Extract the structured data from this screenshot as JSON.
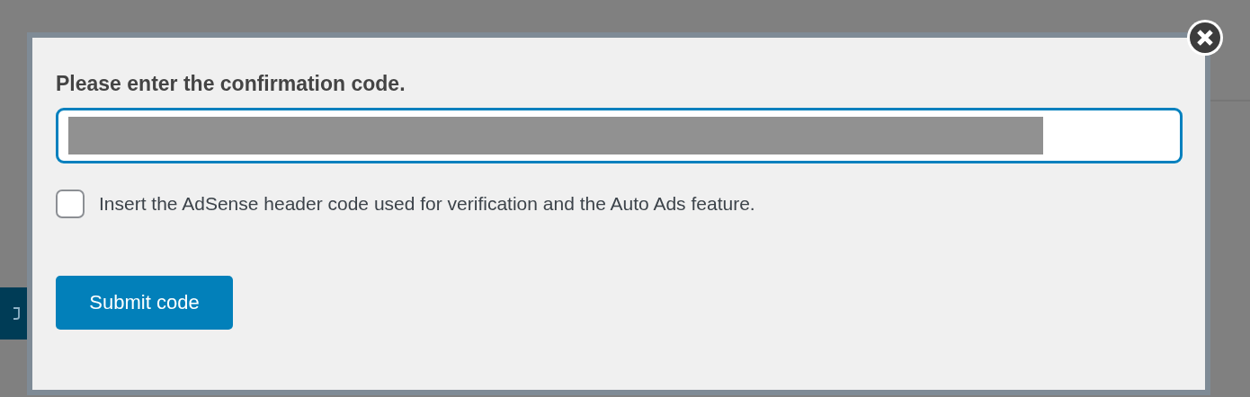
{
  "dialog": {
    "heading": "Please enter the confirmation code.",
    "code_field": {
      "redacted": true
    },
    "checkbox": {
      "label": "Insert the AdSense header code used for verification and the Auto Ads feature.",
      "checked": false
    },
    "submit_button": "Submit code"
  }
}
